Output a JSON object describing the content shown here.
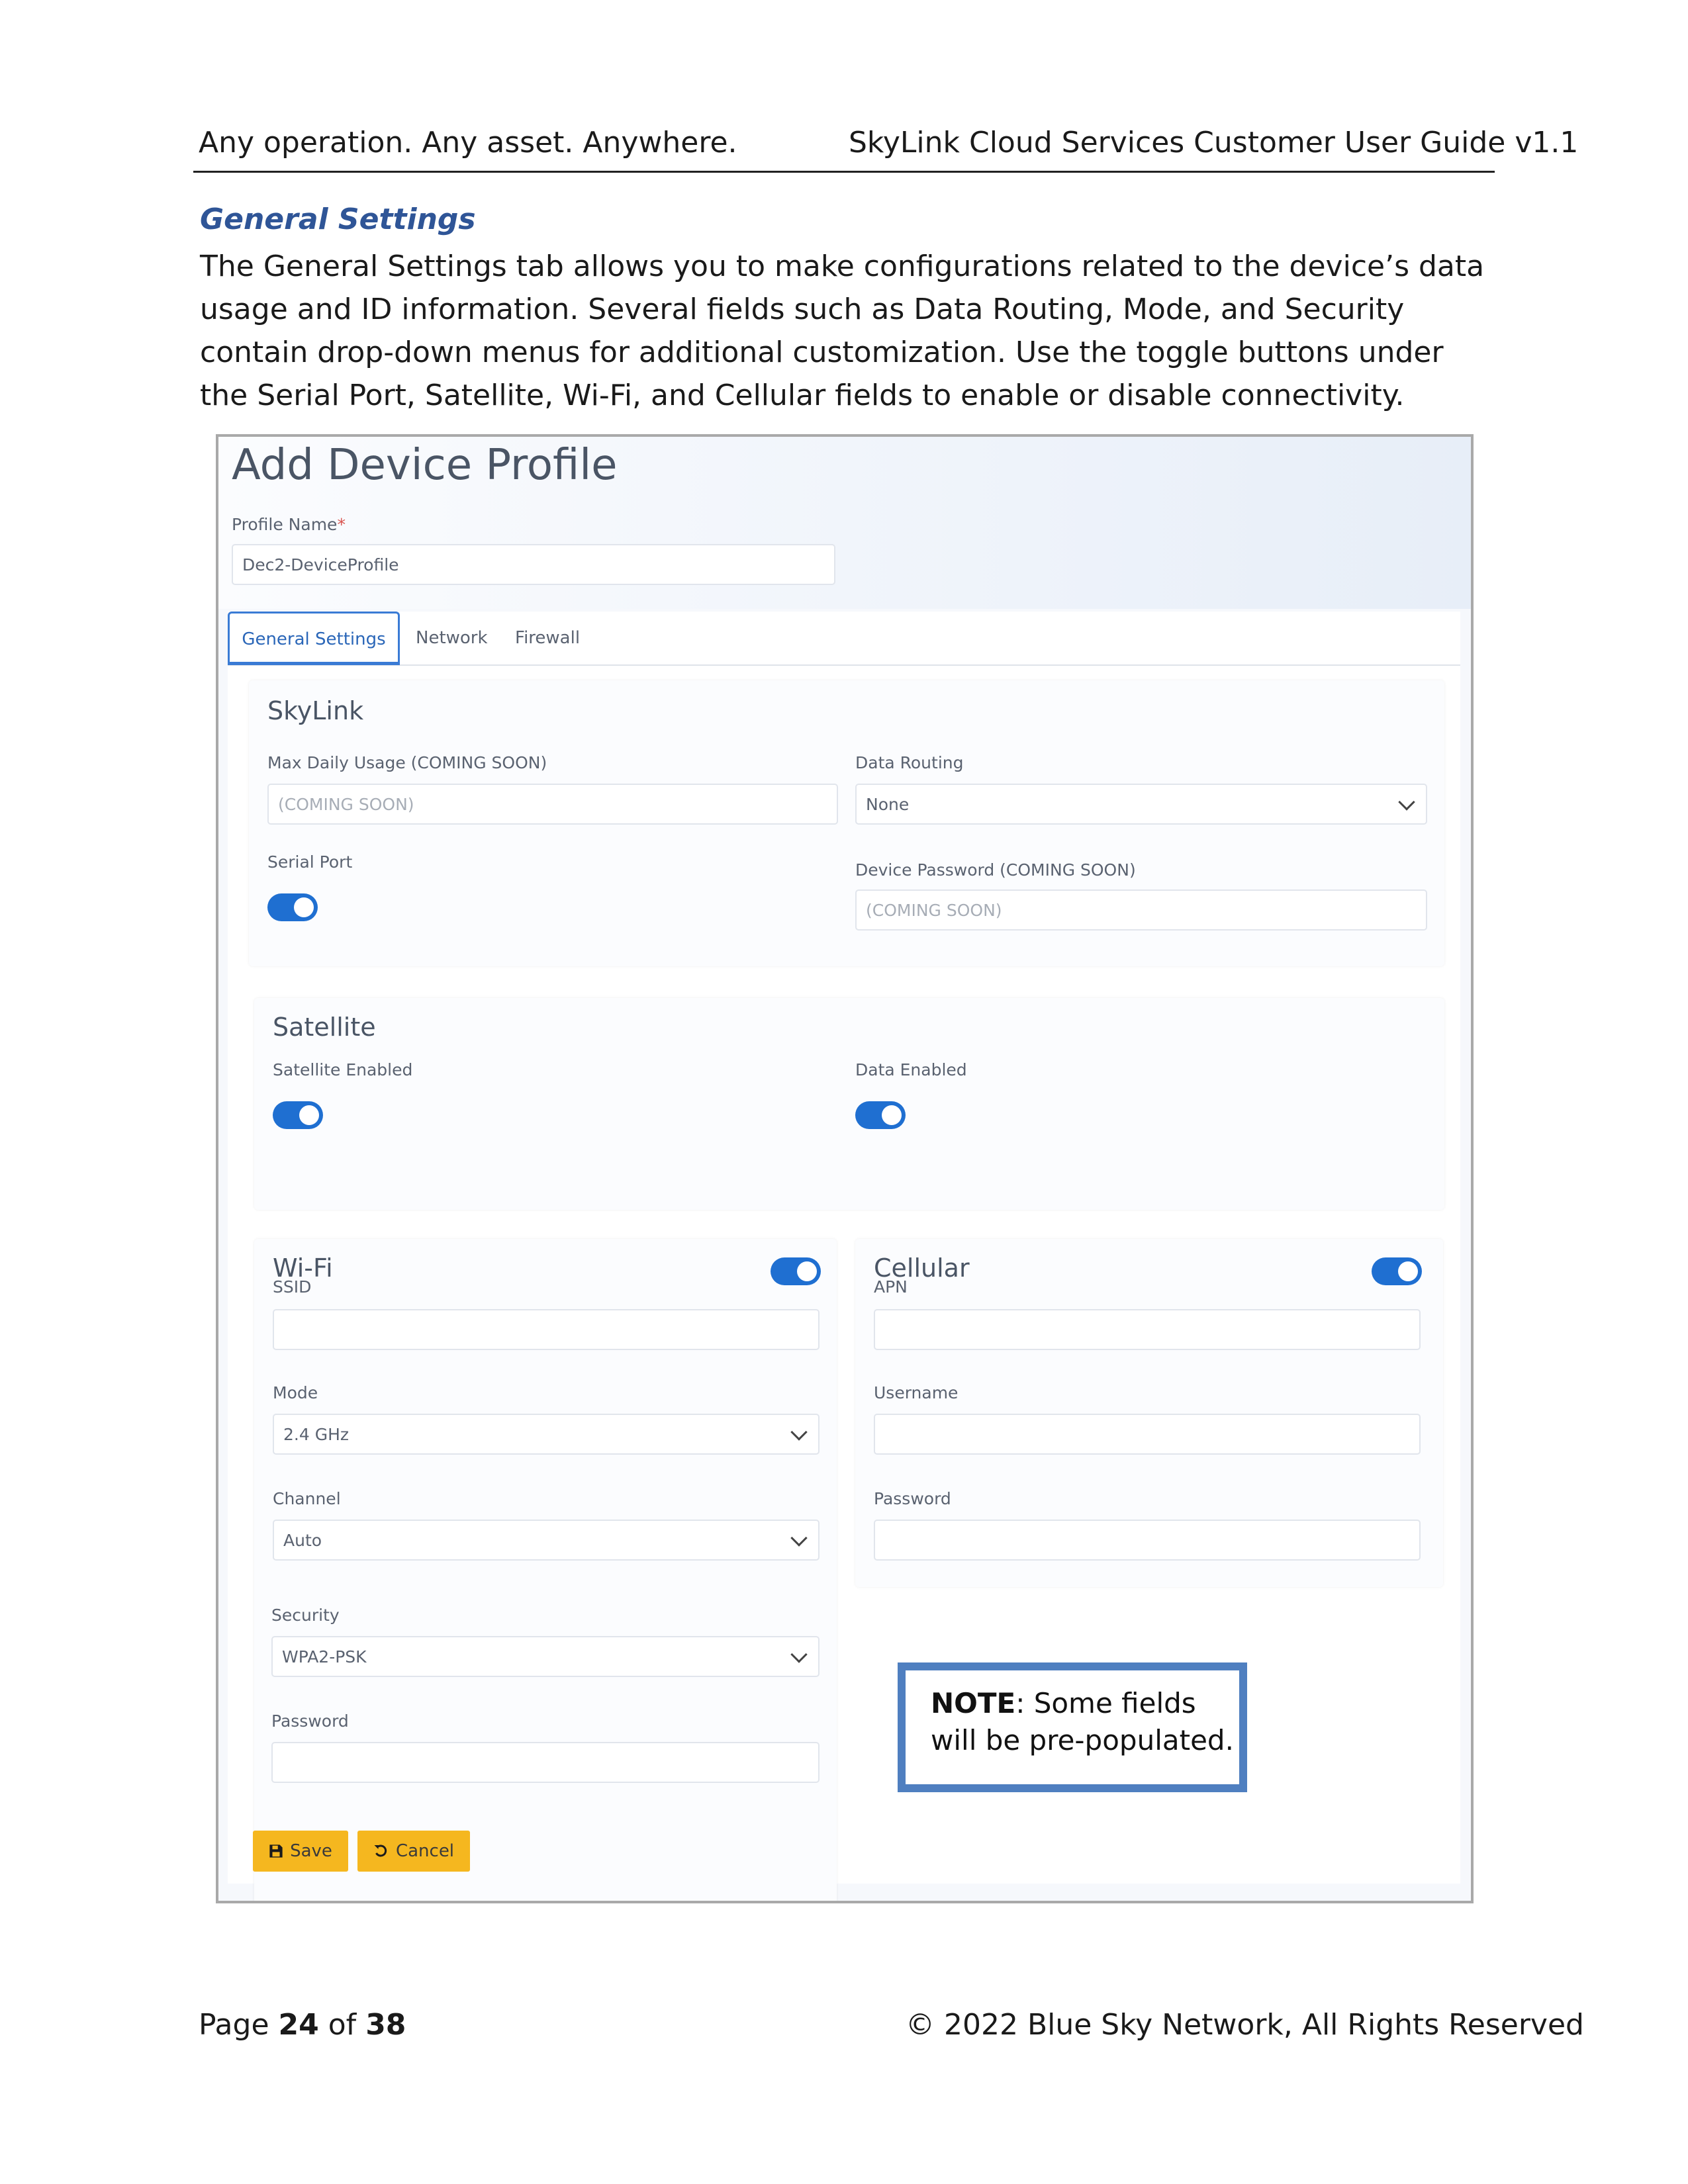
{
  "header": {
    "left": "Any operation. Any asset. Anywhere.",
    "right": "SkyLink Cloud Services Customer User Guide v1.1"
  },
  "section_title": "General Settings",
  "intro": "The General Settings tab allows you to make configurations related to the device’s data usage and ID information. Several fields such as Data Routing, Mode, and Security contain drop-down menus for additional customization. Use the toggle buttons under the Serial Port, Satellite, Wi-Fi, and Cellular fields to enable or disable connectivity.",
  "ui": {
    "title": "Add Device Profile",
    "profile_name_label": "Profile Name",
    "profile_name_required": "*",
    "profile_name_value": "Dec2-DeviceProfile",
    "tabs": [
      "General Settings",
      "Network",
      "Firewall"
    ],
    "skylink": {
      "title": "SkyLink",
      "max_daily_usage_label": "Max Daily Usage (COMING SOON)",
      "max_daily_usage_placeholder": "(COMING SOON)",
      "data_routing_label": "Data Routing",
      "data_routing_value": "None",
      "serial_port_label": "Serial Port",
      "serial_port_on": true,
      "device_password_label": "Device Password (COMING SOON)",
      "device_password_placeholder": "(COMING SOON)"
    },
    "satellite": {
      "title": "Satellite",
      "satellite_enabled_label": "Satellite Enabled",
      "data_enabled_label": "Data Enabled",
      "satellite_enabled_on": true,
      "data_enabled_on": true
    },
    "wifi": {
      "title": "Wi-Fi",
      "enabled": true,
      "ssid_label": "SSID",
      "ssid_value": "",
      "mode_label": "Mode",
      "mode_value": "2.4 GHz",
      "channel_label": "Channel",
      "channel_value": "Auto",
      "security_label": "Security",
      "security_value": "WPA2-PSK",
      "password_label": "Password",
      "password_value": ""
    },
    "cellular": {
      "title": "Cellular",
      "enabled": true,
      "apn_label": "APN",
      "apn_value": "",
      "username_label": "Username",
      "username_value": "",
      "password_label": "Password",
      "password_value": ""
    },
    "save_label": "Save",
    "cancel_label": "Cancel"
  },
  "note": {
    "bold": "NOTE",
    "line1_rest": ": Some fields",
    "line2": "will be pre-populated."
  },
  "footer": {
    "page_prefix": "Page",
    "page_current": "24",
    "page_of": "of",
    "page_total": "38",
    "copyright": "© 2022 Blue Sky Network, All Rights Reserved"
  },
  "colors": {
    "accent": "#1f6fd1",
    "section_title": "#2f5597",
    "button": "#f5b71f",
    "note_border": "#4f7fc0"
  }
}
